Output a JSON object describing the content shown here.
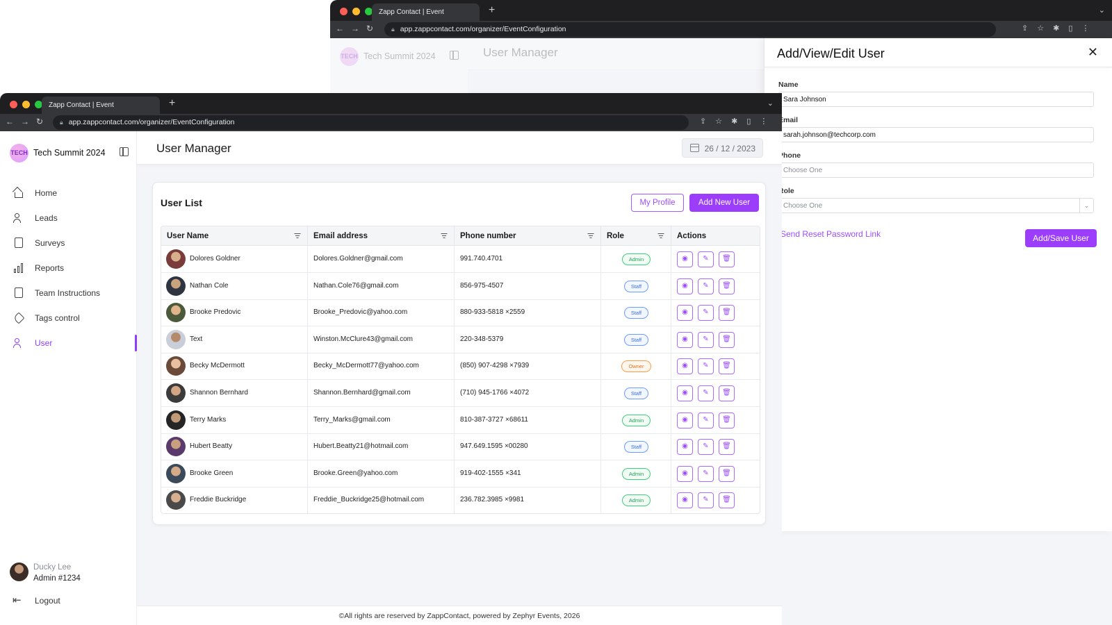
{
  "back_window": {
    "tab_title": "Zapp Contact | Event",
    "url": "app.zappcontact.com/organizer/EventConfiguration",
    "event_name": "Tech Summit 2024",
    "page_title": "User Manager",
    "drawer": {
      "title": "Add/View/Edit User",
      "name_label": "Name",
      "name_value": "Sara Johnson",
      "email_label": "Email",
      "email_value": "sarah.johnson@techcorp.com",
      "phone_label": "Phone",
      "phone_placeholder": "Choose One",
      "role_label": "Role",
      "role_placeholder": "Choose One",
      "reset_link": "Send Reset Password Link",
      "save_button": "Add/Save User"
    }
  },
  "front_window": {
    "tab_title": "Zapp Contact | Event",
    "url": "app.zappcontact.com/organizer/EventConfiguration",
    "sidebar": {
      "logo_text": "TECH",
      "event_name": "Tech Summit 2024",
      "items": [
        {
          "label": "Home",
          "icon": "home-icon"
        },
        {
          "label": "Leads",
          "icon": "leads-icon"
        },
        {
          "label": "Surveys",
          "icon": "clipboard-icon"
        },
        {
          "label": "Reports",
          "icon": "bar-chart-icon"
        },
        {
          "label": "Team Instructions",
          "icon": "document-icon"
        },
        {
          "label": "Tags control",
          "icon": "tag-icon"
        },
        {
          "label": "User",
          "icon": "users-icon",
          "active": true
        }
      ],
      "user_name": "Ducky Lee",
      "user_id": "Admin #1234",
      "logout": "Logout"
    },
    "header": {
      "page_title": "User Manager",
      "date": "26 / 12 / 2023"
    },
    "card": {
      "title": "User List",
      "my_profile": "My Profile",
      "add_new_user": "Add New User",
      "columns": [
        "User Name",
        "Email address",
        "Phone number",
        "Role",
        "Actions"
      ],
      "rows": [
        {
          "name": "Dolores Goldner",
          "email": "Dolores.Goldner@gmail.com",
          "phone": "991.740.4701",
          "role": "Admin"
        },
        {
          "name": "Nathan Cole",
          "email": "Nathan.Cole76@gmail.com",
          "phone": "856-975-4507",
          "role": "Staff"
        },
        {
          "name": "Brooke Predovic",
          "email": "Brooke_Predovic@yahoo.com",
          "phone": "880-933-5818 ×2559",
          "role": "Staff"
        },
        {
          "name": "Text",
          "email": "Winston.McClure43@gmail.com",
          "phone": "220-348-5379",
          "role": "Staff"
        },
        {
          "name": "Becky McDermott",
          "email": "Becky_McDermott77@yahoo.com",
          "phone": "(850) 907-4298 ×7939",
          "role": "Owner"
        },
        {
          "name": "Shannon Bernhard",
          "email": "Shannon.Bernhard@gmail.com",
          "phone": "(710) 945-1766 ×4072",
          "role": "Staff"
        },
        {
          "name": "Terry Marks",
          "email": "Terry_Marks@gmail.com",
          "phone": "810-387-3727 ×68611",
          "role": "Admin"
        },
        {
          "name": "Hubert Beatty",
          "email": "Hubert.Beatty21@hotmail.com",
          "phone": "947.649.1595 ×00280",
          "role": "Staff"
        },
        {
          "name": "Brooke Green",
          "email": "Brooke.Green@yahoo.com",
          "phone": "919-402-1555 ×341",
          "role": "Admin"
        },
        {
          "name": "Freddie Buckridge",
          "email": "Freddie_Buckridge25@hotmail.com",
          "phone": "236.782.3985 ×9981",
          "role": "Admin"
        }
      ]
    },
    "footer": "©All rights are reserved by ZappContact, powered by Zephyr Events, 2026"
  },
  "colors": {
    "accent": "#9b3dfb",
    "admin": "#23a05a",
    "staff": "#3a6fe0",
    "owner": "#e07420"
  }
}
